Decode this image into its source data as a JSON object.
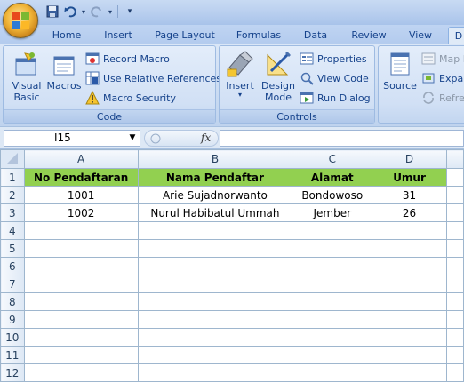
{
  "quick_access": {
    "icons": [
      "save-icon",
      "undo-icon",
      "redo-icon",
      "customize-icon"
    ]
  },
  "tabs": [
    {
      "label": "Home"
    },
    {
      "label": "Insert"
    },
    {
      "label": "Page Layout"
    },
    {
      "label": "Formulas"
    },
    {
      "label": "Data"
    },
    {
      "label": "Review"
    },
    {
      "label": "View"
    },
    {
      "label": "D"
    }
  ],
  "ribbon": {
    "code": {
      "title": "Code",
      "visual_basic": [
        "Visual",
        "Basic"
      ],
      "macros": "Macros",
      "record_macro": "Record Macro",
      "use_relative": "Use Relative References",
      "macro_security": "Macro Security"
    },
    "controls": {
      "title": "Controls",
      "insert": "Insert",
      "design_mode": [
        "Design",
        "Mode"
      ],
      "properties": "Properties",
      "view_code": "View Code",
      "run_dialog": "Run Dialog"
    },
    "xml": {
      "source": "Source",
      "map_properties": "Map I",
      "expansion_packs": "Expar",
      "refresh_data": "Refre"
    }
  },
  "formula_bar": {
    "name_box": "I15",
    "fx": "fx",
    "formula": ""
  },
  "sheet": {
    "columns": [
      "A",
      "B",
      "C",
      "D"
    ],
    "rows": [
      "1",
      "2",
      "3",
      "4",
      "5",
      "6",
      "7",
      "8",
      "9",
      "10",
      "11",
      "12"
    ],
    "header": [
      "No Pendaftaran",
      "Nama Pendaftar",
      "Alamat",
      "Umur"
    ],
    "data": [
      [
        "1001",
        "Arie Sujadnorwanto",
        "Bondowoso",
        "31"
      ],
      [
        "1002",
        "Nurul Habibatul Ummah",
        "Jember",
        "26"
      ]
    ]
  },
  "colors": {
    "header_fill": "#92d050",
    "grid_line": "#9eb6ce",
    "ribbon_bg": "#dbe7f7"
  }
}
